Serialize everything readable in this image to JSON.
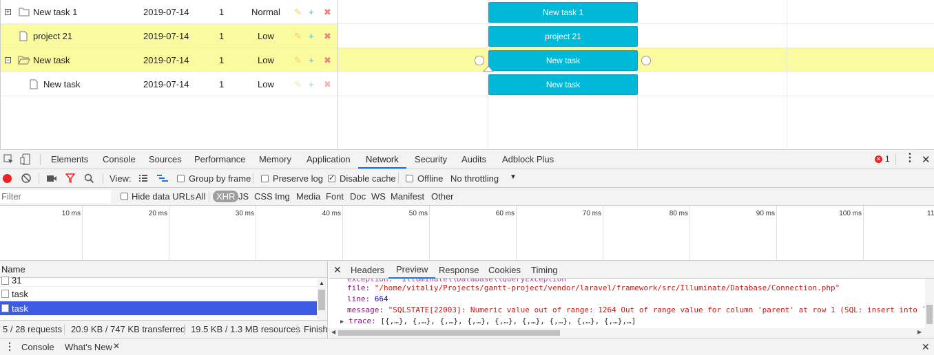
{
  "gantt": {
    "rows": [
      {
        "toggle": "+",
        "name": "New task 1",
        "date": "2019-07-14",
        "duration": "1",
        "priority": "Normal",
        "bar": "New task 1"
      },
      {
        "toggle": "",
        "name": "project 21",
        "date": "2019-07-14",
        "duration": "1",
        "priority": "Low",
        "bar": "project 21"
      },
      {
        "toggle": "−",
        "name": "New task",
        "date": "2019-07-14",
        "duration": "1",
        "priority": "Low",
        "bar": "New task"
      },
      {
        "toggle": "",
        "name": "New task",
        "date": "2019-07-14",
        "duration": "1",
        "priority": "Low",
        "bar": "New task"
      }
    ],
    "actions": {
      "edit": "✎",
      "add": "+",
      "delete": "✖"
    }
  },
  "devtools": {
    "tabs": [
      "Elements",
      "Console",
      "Sources",
      "Performance",
      "Memory",
      "Application",
      "Network",
      "Security",
      "Audits",
      "Adblock Plus"
    ],
    "error_count": "1",
    "toolbar": {
      "view_label": "View:",
      "group_by_frame": "Group by frame",
      "preserve_log": "Preserve log",
      "disable_cache": "Disable cache",
      "offline": "Offline",
      "throttling": "No throttling"
    },
    "filter": {
      "placeholder": "Filter",
      "hide_data_urls": "Hide data URLs",
      "types": [
        "All",
        "XHR",
        "JS",
        "CSS",
        "Img",
        "Media",
        "Font",
        "Doc",
        "WS",
        "Manifest",
        "Other"
      ]
    },
    "timeline_ticks": [
      "10 ms",
      "20 ms",
      "30 ms",
      "40 ms",
      "50 ms",
      "60 ms",
      "70 ms",
      "80 ms",
      "90 ms",
      "100 ms",
      "11"
    ],
    "requests": {
      "header": "Name",
      "items": [
        "31",
        "task",
        "task"
      ]
    },
    "detail_tabs": [
      "Headers",
      "Preview",
      "Response",
      "Cookies",
      "Timing"
    ],
    "preview": {
      "file_key": "file:",
      "file_val": "\"/home/vitaliy/Projects/gantt-project/vendor/laravel/framework/src/Illuminate/Database/Connection.php\"",
      "line_key": "line:",
      "line_val": "664",
      "message_key": "message:",
      "message_val": "\"SQLSTATE[22003]: Numeric value out of range: 1264 Out of range value for column 'parent' at row 1 (SQL: insert into `",
      "trace_key": "trace:",
      "trace_val": "[{,…}, {,…}, {,…}, {,…}, {,…}, {,…}, {,…}, {,…}, {,…},…]"
    },
    "status": {
      "requests": "5 / 28 requests",
      "transferred": "20.9 KB / 747 KB transferred",
      "resources": "19.5 KB / 1.3 MB resources",
      "finish": "Finish"
    },
    "drawer_tabs": [
      "Console",
      "What's New"
    ]
  }
}
